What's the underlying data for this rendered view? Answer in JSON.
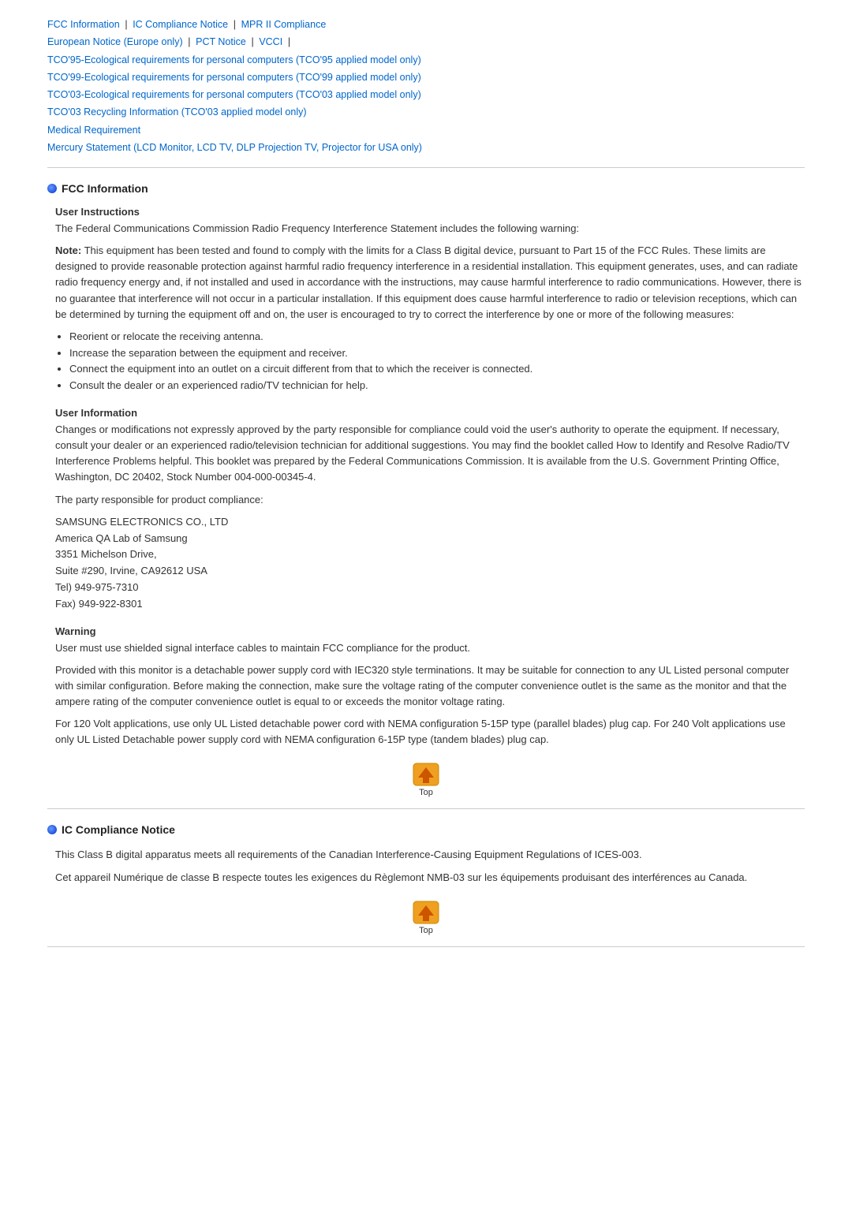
{
  "nav": {
    "links": [
      {
        "label": "FCC Information",
        "id": "fcc"
      },
      {
        "label": "IC Compliance Notice",
        "id": "ic"
      },
      {
        "label": "MPR II Compliance",
        "id": "mpr"
      },
      {
        "label": "European Notice (Europe only)",
        "id": "euro"
      },
      {
        "label": "PCT Notice",
        "id": "pct"
      },
      {
        "label": "VCCI",
        "id": "vcci"
      },
      {
        "label": "TCO'95-Ecological requirements for personal computers (TCO'95 applied model only)",
        "id": "tco95"
      },
      {
        "label": "TCO'99-Ecological requirements for personal computers (TCO'99 applied model only)",
        "id": "tco99"
      },
      {
        "label": "TCO'03-Ecological requirements for personal computers (TCO'03 applied model only)",
        "id": "tco03"
      },
      {
        "label": "TCO'03 Recycling Information (TCO'03 applied model only)",
        "id": "tco03rec"
      },
      {
        "label": "Medical Requirement",
        "id": "medical"
      },
      {
        "label": "Mercury Statement (LCD Monitor, LCD TV, DLP Projection TV, Projector for USA only)",
        "id": "mercury"
      }
    ]
  },
  "sections": {
    "fcc": {
      "title": "FCC Information",
      "user_instructions": {
        "title": "User Instructions",
        "intro": "The Federal Communications Commission Radio Frequency Interference Statement includes the following warning:",
        "note_label": "Note:",
        "note_text": " This equipment has been tested and found to comply with the limits for a Class B digital device, pursuant to Part 15 of the FCC Rules. These limits are designed to provide reasonable protection against harmful radio frequency interference in a residential installation. This equipment generates, uses, and can radiate radio frequency energy and, if not installed and used in accordance with the instructions, may cause harmful interference to radio communications. However, there is no guarantee that interference will not occur in a particular installation. If this equipment does cause harmful interference to radio or television receptions, which can be determined by turning the equipment off and on, the user is encouraged to try to correct the interference by one or more of the following measures:",
        "bullets": [
          "Reorient or relocate the receiving antenna.",
          "Increase the separation between the equipment and receiver.",
          "Connect the equipment into an outlet on a circuit different from that to which the receiver is connected.",
          "Consult the dealer or an experienced radio/TV technician for help."
        ]
      },
      "user_information": {
        "title": "User Information",
        "text1": "Changes or modifications not expressly approved by the party responsible for compliance could void the user's authority to operate the equipment. If necessary, consult your dealer or an experienced radio/television technician for additional suggestions. You may find the booklet called How to Identify and Resolve Radio/TV Interference Problems helpful. This booklet was prepared by the Federal Communications Commission. It is available from the U.S. Government Printing Office, Washington, DC 20402, Stock Number 004-000-00345-4.",
        "text2": "The party responsible for product compliance:",
        "address": "SAMSUNG ELECTRONICS CO., LTD\nAmerica QA Lab of Samsung\n3351 Michelson Drive,\nSuite #290, Irvine, CA92612 USA\nTel) 949-975-7310\nFax) 949-922-8301"
      },
      "warning": {
        "title": "Warning",
        "text1": "User must use shielded signal interface cables to maintain FCC compliance for the product.",
        "text2": "Provided with this monitor is a detachable power supply cord with IEC320 style terminations. It may be suitable for connection to any UL Listed personal computer with similar configuration. Before making the connection, make sure the voltage rating of the computer convenience outlet is the same as the monitor and that the ampere rating of the computer convenience outlet is equal to or exceeds the monitor voltage rating.",
        "text3": "For 120 Volt applications, use only UL Listed detachable power cord with NEMA configuration 5-15P type (parallel blades) plug cap. For 240 Volt applications use only UL Listed Detachable power supply cord with NEMA configuration 6-15P type (tandem blades) plug cap."
      }
    },
    "ic": {
      "title": "IC Compliance Notice",
      "text1": "This Class B digital apparatus meets all requirements of the Canadian Interference-Causing Equipment Regulations of ICES-003.",
      "text2": "Cet appareil Numérique de classe B respecte toutes les exigences du Règlemont NMB-03 sur les équipements produisant des interférences au Canada."
    }
  },
  "top_button_label": "Top"
}
